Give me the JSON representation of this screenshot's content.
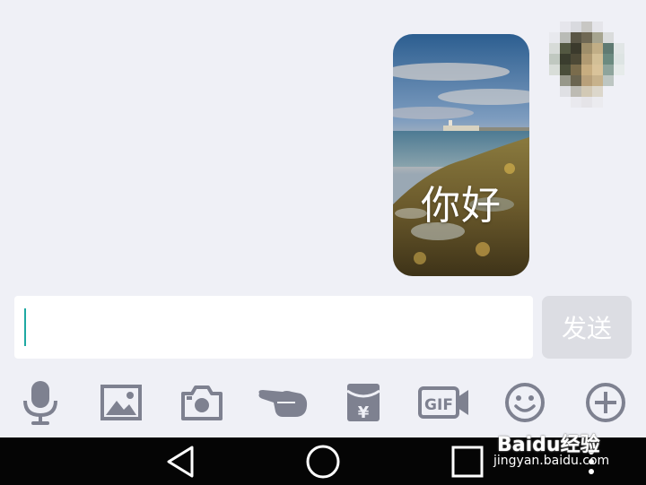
{
  "chat": {
    "message_text": "你好"
  },
  "composer": {
    "input_value": "",
    "send_label": "发送"
  },
  "toolbar": {
    "icons": [
      "microphone-icon",
      "image-icon",
      "camera-icon",
      "pointing-hand-icon",
      "red-envelope-icon",
      "gif-icon",
      "emoji-icon",
      "plus-icon"
    ],
    "gif_label": "GIF",
    "yen_label": "¥"
  },
  "navbar": {
    "icons": [
      "back-icon",
      "home-icon",
      "recents-icon",
      "more-icon"
    ]
  },
  "watermark": {
    "main": "Baidu经验",
    "url": "jingyan.baidu.com"
  },
  "colors": {
    "background": "#eff0f6",
    "icon": "#7e8190",
    "send_disabled": "#dcdde3",
    "cursor": "#1fa9a2",
    "navbar": "#050505"
  }
}
